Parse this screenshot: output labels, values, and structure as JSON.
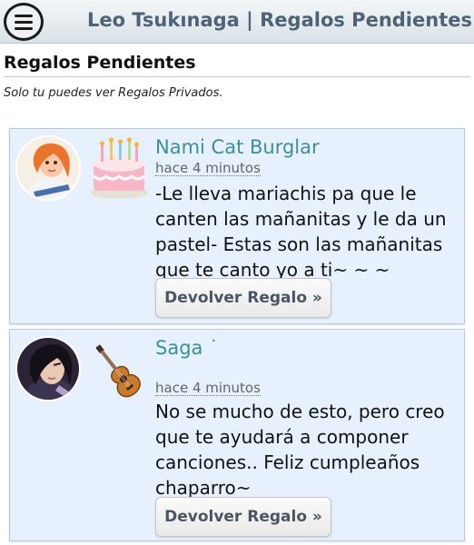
{
  "header": {
    "title": "Leo Tsukınaga | Regalos Pendientes"
  },
  "page": {
    "heading": "Regalos Pendientes",
    "notice": "Solo tu puedes ver Regalos Privados."
  },
  "gifts": [
    {
      "sender": "Nami Cat Burglar",
      "time": "hace 4 minutos",
      "message": "-Le lleva mariachis pa que le canten las mañanitas y le da un pastel- Estas son las mañanitas que te canto yo a ti~ ~ ~",
      "gift_icon": "birthday-cake-icon",
      "button": "Devolver Regalo »"
    },
    {
      "sender": "Saga ˙",
      "time": "hace 4 minutos",
      "message": "No se mucho de esto, pero creo que te ayudará a componer canciones.. Feliz cumpleaños chaparro~",
      "gift_icon": "guitar-icon",
      "button": "Devolver Regalo »"
    }
  ],
  "colors": {
    "card_bg": "#e7f1fd",
    "sender_name": "#3a8f98",
    "header_title": "#4f6277"
  }
}
